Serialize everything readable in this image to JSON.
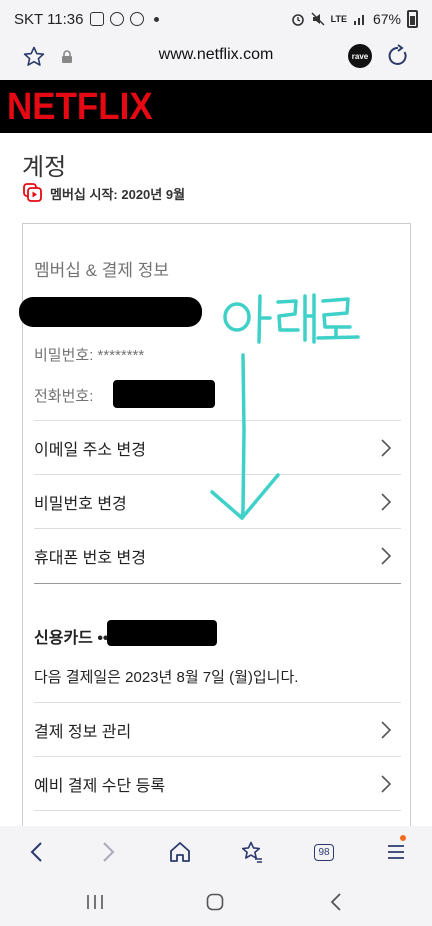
{
  "status_bar": {
    "carrier_time": "SKT 11:36",
    "network": "LTE",
    "battery": "67%"
  },
  "browser": {
    "url": "www.netflix.com",
    "rave_label": "rave"
  },
  "netflix": {
    "logo": "NETFLIX",
    "brand_color": "#e50914"
  },
  "account": {
    "title": "계정",
    "member_since": "멤버십 시작: 2020년 9월",
    "membership_section_title": "멤버십 & 결제 정보",
    "password_label": "비밀번호: ********",
    "phone_label": "전화번호: ",
    "actions": [
      {
        "label": "이메일 주소 변경"
      },
      {
        "label": "비밀번호 변경"
      },
      {
        "label": "휴대폰 번호 변경"
      }
    ],
    "credit_card_label": "신용카드 ••",
    "next_payment": "다음 결제일은 2023년 8월 7일 (월)입니다.",
    "billing_actions": [
      {
        "label": "결제 정보 관리"
      },
      {
        "label": "예비 결제 수단 등록"
      }
    ]
  },
  "annotation": {
    "text": "아래로",
    "color": "#3fd1c8"
  },
  "toolbar": {
    "tabs_count": "98"
  }
}
